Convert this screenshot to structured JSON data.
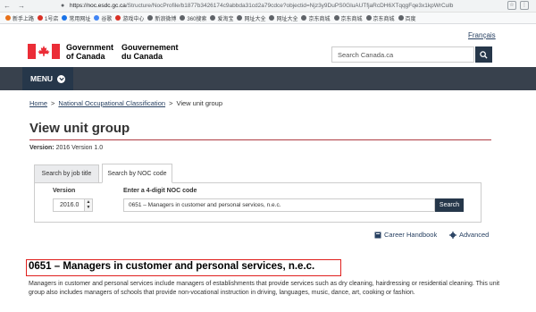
{
  "browser": {
    "url_host": "https://noc.esdc.gc.ca",
    "url_path": "/Structure/NocProfile/b1877b3426174c9abbda31cd2a79cdce?objectid=Njz3y9DuPS0GluAUTfjaRcDH6XTqqgFqe3x1kpWrCulb",
    "bookmarks": [
      {
        "label": "新手上路",
        "color": "#e8711a"
      },
      {
        "label": "1号店",
        "color": "#d93025"
      },
      {
        "label": "常用网址",
        "color": "#1a73e8"
      },
      {
        "label": "谷歌",
        "color": "#4285f4"
      },
      {
        "label": "游戏中心",
        "color": "#d93025"
      },
      {
        "label": "新浪微博",
        "color": "#5f6368"
      },
      {
        "label": "360搜索",
        "color": "#5f6368"
      },
      {
        "label": "爱淘宝",
        "color": "#5f6368"
      },
      {
        "label": "网址大全",
        "color": "#5f6368"
      },
      {
        "label": "网址大全",
        "color": "#5f6368"
      },
      {
        "label": "京东商城",
        "color": "#5f6368"
      },
      {
        "label": "京东商城",
        "color": "#5f6368"
      },
      {
        "label": "京东商城",
        "color": "#5f6368"
      },
      {
        "label": "百度",
        "color": "#5f6368"
      }
    ]
  },
  "header": {
    "language_link": "Français",
    "wordmark_en_1": "Government",
    "wordmark_en_2": "of Canada",
    "wordmark_fr_1": "Gouvernement",
    "wordmark_fr_2": "du Canada",
    "search_placeholder": "Search Canada.ca",
    "menu_label": "MENU"
  },
  "breadcrumb": {
    "home": "Home",
    "noc": "National Occupational Classification",
    "current": "View unit group",
    "sep": ">"
  },
  "page": {
    "title": "View unit group",
    "version_label": "Version:",
    "version_value": "2016 Version 1.0"
  },
  "search": {
    "tab_job_title": "Search by job title",
    "tab_noc_code": "Search by NOC code",
    "version_label": "Version",
    "version_selected": "2016.0",
    "code_label": "Enter a 4-digit NOC code",
    "code_value": "0651 – Managers in customer and personal services, n.e.c.",
    "search_button": "Search",
    "career_handbook": "Career Handbook",
    "advanced": "Advanced"
  },
  "unit_group": {
    "title": "0651 – Managers in customer and personal services, n.e.c.",
    "description": "Managers in customer and personal services include managers of establishments that provide services such as dry cleaning, hairdressing or residential cleaning. This unit group also includes managers of schools that provide non-vocational instruction in driving, languages, music, dance, art, cooking or fashion."
  },
  "colors": {
    "brand_dark": "#26374a",
    "menu_bar": "#38414d",
    "link": "#284162",
    "rule": "#af3c43",
    "highlight_box": "#e0201e",
    "flag_red": "#eb2d37"
  }
}
